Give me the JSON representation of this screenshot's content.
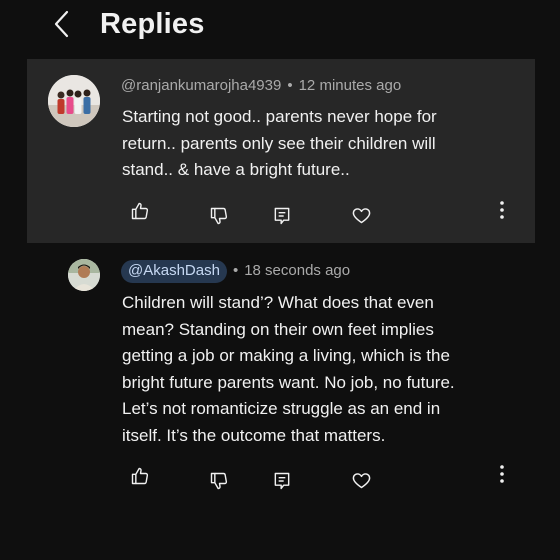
{
  "header": {
    "title": "Replies"
  },
  "parent_comment": {
    "author": "@ranjankumarojha4939",
    "time": "12 minutes ago",
    "lines": [
      "Starting not good.. parents never hope for",
      "return..  parents only see their children will",
      "stand.. & have a bright future.."
    ]
  },
  "reply": {
    "author": "@AkashDash",
    "time": "18 seconds ago",
    "lines": [
      "Children will stand’? What does that even",
      "mean? Standing on their own feet implies",
      "getting a job or making a living, which is the",
      "bright future parents want. No job, no future.",
      "Let’s not romanticize struggle as an end in",
      "itself. It’s the outcome that matters."
    ]
  },
  "icons": {
    "back": "chevron-left-icon",
    "like": "thumbs-up-icon",
    "dislike": "thumbs-down-icon",
    "reply": "comment-reply-icon",
    "heart": "heart-icon",
    "more": "more-vertical-icon"
  },
  "colors": {
    "background": "#0f0f0f",
    "card": "#272727",
    "text": "#f1f1f1",
    "meta": "#aaaaaa",
    "mention_bg": "#263850",
    "mention_text": "#c6d8f2"
  }
}
